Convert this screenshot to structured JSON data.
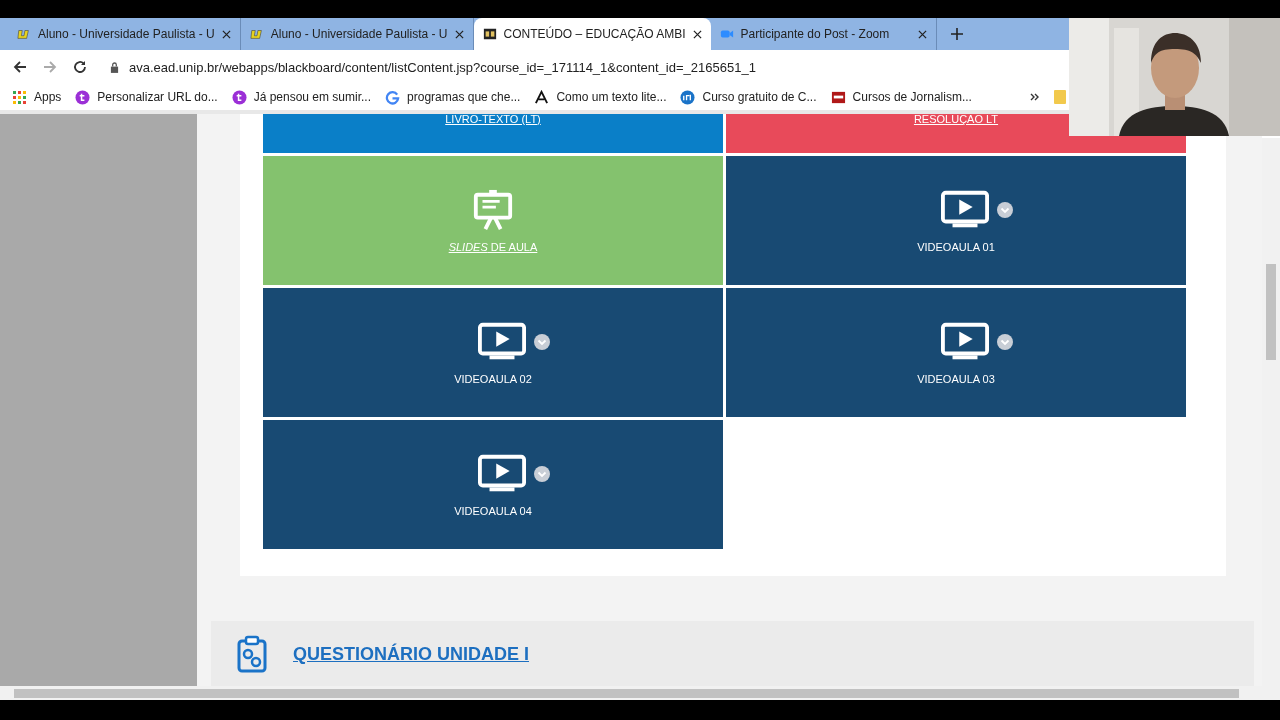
{
  "tabs": [
    {
      "title": "Aluno - Universidade Paulista - U",
      "selected": false
    },
    {
      "title": "Aluno - Universidade Paulista - U",
      "selected": false
    },
    {
      "title": "CONTEÚDO – EDUCAÇÃO AMBI",
      "selected": true
    },
    {
      "title": "Participante do Post - Zoom",
      "selected": false
    }
  ],
  "address": "ava.ead.unip.br/webapps/blackboard/content/listContent.jsp?course_id=_171114_1&content_id=_2165651_1",
  "bookmarks": [
    {
      "label": "Apps"
    },
    {
      "label": "Personalizar URL do..."
    },
    {
      "label": "Já pensou em sumir..."
    },
    {
      "label": "programas que che..."
    },
    {
      "label": "Como um texto lite..."
    },
    {
      "label": "Curso gratuito de C..."
    },
    {
      "label": "Cursos de Jornalism..."
    }
  ],
  "tiles": [
    {
      "kind": "link",
      "label": "LIVRO-TEXTO (LT)",
      "color": "#0a7fc8"
    },
    {
      "kind": "link",
      "label": "RESOLUÇAO LT",
      "color": "#e84a5a"
    },
    {
      "kind": "slides",
      "label": "*SLIDES* DE AULA",
      "color": "#84c26e"
    },
    {
      "kind": "video",
      "label": "VIDEOAULA 01",
      "color": "#184a73"
    },
    {
      "kind": "video",
      "label": "VIDEOAULA 02",
      "color": "#184a73"
    },
    {
      "kind": "video",
      "label": "VIDEOAULA 03",
      "color": "#184a73"
    },
    {
      "kind": "video",
      "label": "VIDEOAULA 04",
      "color": "#184a73"
    }
  ],
  "section": {
    "title": "QUESTIONÁRIO UNIDADE I"
  }
}
